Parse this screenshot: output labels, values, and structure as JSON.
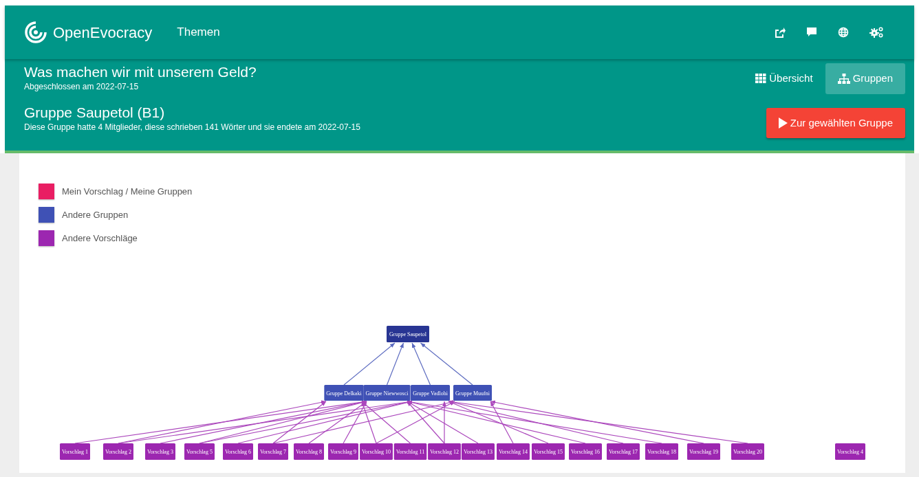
{
  "navbar": {
    "brand": "OpenEvocracy",
    "links": [
      "Themen"
    ]
  },
  "topic": {
    "title": "Was machen wir mit unserem Geld?",
    "subtitle": "Abgeschlossen am 2022-07-15"
  },
  "group": {
    "title": "Gruppe Saupetol (B1)",
    "description": "Diese Gruppe hatte 4 Mitglieder, diese schrieben 141 Wörter und sie endete am 2022-07-15"
  },
  "views": [
    {
      "label": "Übersicht",
      "kind": "grid",
      "selected": false
    },
    {
      "label": "Gruppen",
      "kind": "tree",
      "selected": true
    }
  ],
  "action_button": "Zur gewählten Gruppe",
  "legend": [
    {
      "label": "Mein Vorschlag / Meine Gruppen",
      "color": "#e91e63"
    },
    {
      "label": "Andere Gruppen",
      "color": "#3f51b5"
    },
    {
      "label": "Andere Vorschläge",
      "color": "#9c27b0"
    }
  ],
  "diagram": {
    "root": "Gruppe Saupetol",
    "groups": [
      "Gruppe Delkaki",
      "Gruppe Niewwosci",
      "Gruppe Vadlohi",
      "Gruppe Muufni"
    ],
    "proposals": [
      "Vorschlag 1",
      "Vorschlag 2",
      "Vorschlag 3",
      "Vorschlag 5",
      "Vorschlag 6",
      "Vorschlag 7",
      "Vorschlag 8",
      "Vorschlag 9",
      "Vorschlag 10",
      "Vorschlag 11",
      "Vorschlag 12",
      "Vorschlag 13",
      "Vorschlag 14",
      "Vorschlag 15",
      "Vorschlag 16",
      "Vorschlag 17",
      "Vorschlag 18",
      "Vorschlag 19",
      "Vorschlag 20",
      "Vorschlag 4"
    ]
  }
}
